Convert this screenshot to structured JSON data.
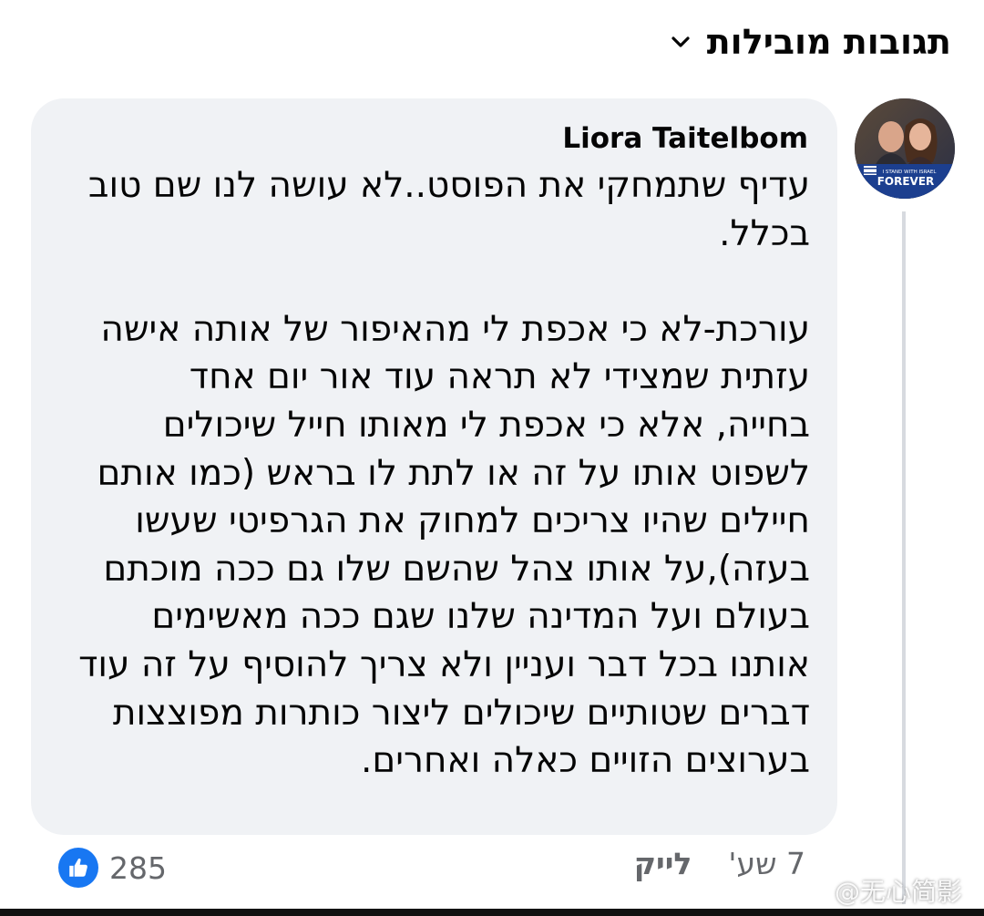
{
  "header": {
    "sort_label": "תגובות מובילות",
    "chevron_icon": "chevron-down-icon"
  },
  "comment": {
    "avatar": {
      "icon": "profile-photo",
      "badge_line1": "I STAND WITH ISRAEL",
      "badge_line2": "FOREVER"
    },
    "author": "Liora Taitelbom",
    "lines": [
      "עדיף שתמחקי את הפוסט..לא עושה לנו שם טוב",
      "בכלל.",
      "",
      "עורכת-לא כי אכפת לי מהאיפור של אותה אישה",
      "עזתית שמצידי לא תראה עוד אור יום אחד",
      "בחייה, אלא כי אכפת לי מאותו חייל שיכולים",
      "לשפוט אותו על זה או לתת לו בראש (כמו אותם",
      "חיילים שהיו צריכים למחוק את הגרפיטי שעשו",
      "בעזה),על אותו צהל שהשם שלו גם ככה מוכתם",
      "בעולם ועל המדינה שלנו שגם ככה מאשימים",
      "אותנו בכל דבר ועניין ולא צריך להוסיף על זה עוד",
      "דברים שטותיים שיכולים ליצור כותרות מפוצצות",
      "בערוצים הזויים כאלה ואחרים."
    ],
    "timestamp": "7 שע'",
    "like_label": "לייק",
    "reaction_icon": "thumbs-up-icon",
    "reaction_count": "285",
    "colors": {
      "bubble": "#f0f2f5",
      "like_blue": "#1877f2",
      "meta_gray": "#65676b"
    }
  },
  "watermark": {
    "text": "@无心简影"
  }
}
